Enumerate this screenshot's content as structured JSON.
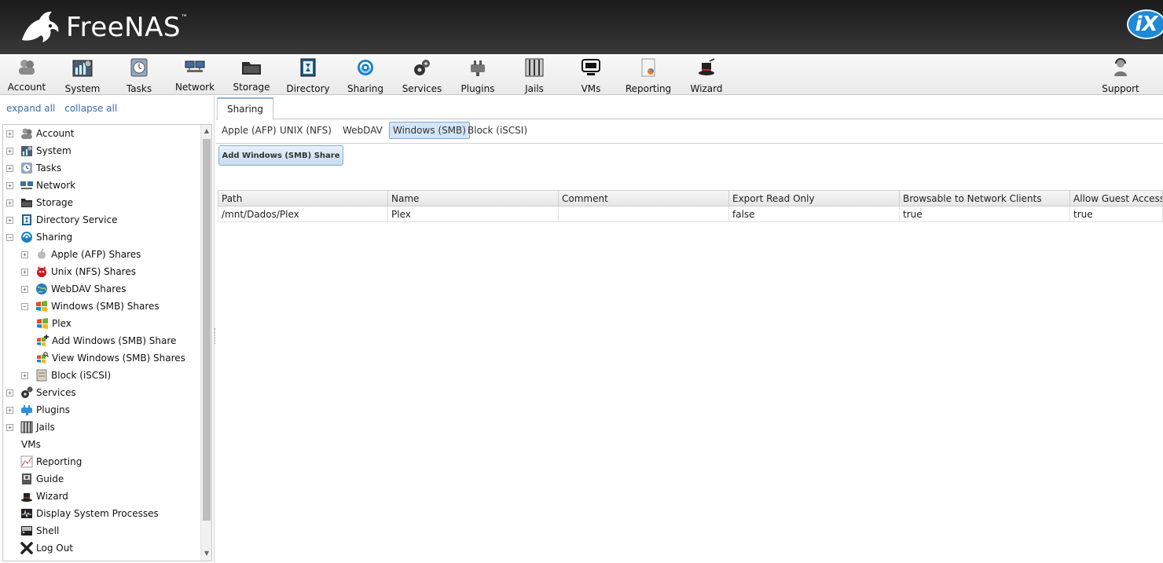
{
  "header": {
    "app_name": "FreeNAS",
    "trademark": "™",
    "vendor_logo": "iX"
  },
  "toolbar": {
    "items": [
      {
        "label": "Account",
        "icon": "account-icon"
      },
      {
        "label": "System",
        "icon": "system-icon"
      },
      {
        "label": "Tasks",
        "icon": "tasks-icon"
      },
      {
        "label": "Network",
        "icon": "network-icon"
      },
      {
        "label": "Storage",
        "icon": "storage-icon"
      },
      {
        "label": "Directory",
        "icon": "directory-icon"
      },
      {
        "label": "Sharing",
        "icon": "sharing-icon"
      },
      {
        "label": "Services",
        "icon": "services-icon"
      },
      {
        "label": "Plugins",
        "icon": "plugins-icon"
      },
      {
        "label": "Jails",
        "icon": "jails-icon"
      },
      {
        "label": "VMs",
        "icon": "vms-icon"
      },
      {
        "label": "Reporting",
        "icon": "reporting-icon"
      },
      {
        "label": "Wizard",
        "icon": "wizard-icon"
      }
    ],
    "support": {
      "label": "Support",
      "icon": "support-icon"
    }
  },
  "left": {
    "expand_all": "expand all",
    "collapse_all": "collapse all",
    "tree": [
      {
        "label": "Account",
        "icon": "account-icon",
        "expander": "+"
      },
      {
        "label": "System",
        "icon": "system-icon",
        "expander": "+"
      },
      {
        "label": "Tasks",
        "icon": "tasks-icon",
        "expander": "+"
      },
      {
        "label": "Network",
        "icon": "network-icon",
        "expander": "+"
      },
      {
        "label": "Storage",
        "icon": "storage-icon",
        "expander": "+"
      },
      {
        "label": "Directory Service",
        "icon": "directory-icon",
        "expander": "+"
      },
      {
        "label": "Sharing",
        "icon": "sharing-icon",
        "expander": "−"
      },
      {
        "label": "Apple (AFP) Shares",
        "icon": "apple-icon",
        "expander": "+"
      },
      {
        "label": "Unix (NFS) Shares",
        "icon": "bsd-daemon-icon",
        "expander": "+"
      },
      {
        "label": "WebDAV Shares",
        "icon": "webdav-globe-icon",
        "expander": "+"
      },
      {
        "label": "Windows (SMB) Shares",
        "icon": "windows-flag-icon",
        "expander": "−"
      },
      {
        "label": "Plex",
        "icon": "windows-flag-icon",
        "expander": ""
      },
      {
        "label": "Add Windows (SMB) Share",
        "icon": "windows-add-icon",
        "expander": ""
      },
      {
        "label": "View Windows (SMB) Shares",
        "icon": "windows-view-icon",
        "expander": ""
      },
      {
        "label": "Block (iSCSI)",
        "icon": "block-disk-icon",
        "expander": "+"
      },
      {
        "label": "Services",
        "icon": "services-icon",
        "expander": "+"
      },
      {
        "label": "Plugins",
        "icon": "plugins-icon",
        "expander": "+"
      },
      {
        "label": "Jails",
        "icon": "jails-icon",
        "expander": "+"
      },
      {
        "label": "VMs",
        "icon": "",
        "expander": ""
      },
      {
        "label": "Reporting",
        "icon": "reporting-icon",
        "expander": ""
      },
      {
        "label": "Guide",
        "icon": "guide-icon",
        "expander": ""
      },
      {
        "label": "Wizard",
        "icon": "wizard-icon",
        "expander": ""
      },
      {
        "label": "Display System Processes",
        "icon": "processes-icon",
        "expander": ""
      },
      {
        "label": "Shell",
        "icon": "shell-icon",
        "expander": ""
      },
      {
        "label": "Log Out",
        "icon": "logout-x-icon",
        "expander": ""
      }
    ]
  },
  "main": {
    "tab": "Sharing",
    "sub_tabs": [
      "Apple (AFP)",
      "UNIX (NFS)",
      "WebDAV",
      "Windows (SMB)",
      "Block (iSCSI)"
    ],
    "active_sub_tab": "Windows (SMB)",
    "add_button": "Add Windows (SMB) Share",
    "table": {
      "columns": [
        "Path",
        "Name",
        "Comment",
        "Export Read Only",
        "Browsable to Network Clients",
        "Allow Guest Access"
      ],
      "rows": [
        [
          "/mnt/Dados/Plex",
          "Plex",
          "",
          "false",
          "true",
          "true"
        ]
      ]
    }
  },
  "colors": {
    "header_bg": "#222222",
    "accent_blue": "#1e8ad6",
    "active_tab": "#d3e6f7",
    "link": "#3a6ea5"
  }
}
